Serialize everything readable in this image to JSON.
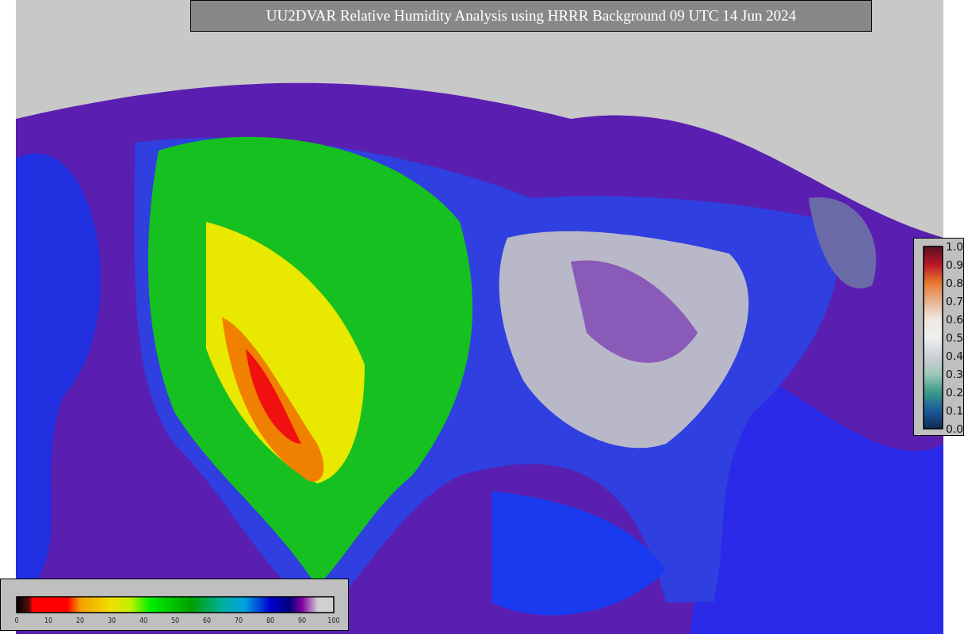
{
  "title": "UU2DVAR Relative Humidity Analysis using HRRR Background 09 UTC 14 Jun 2024",
  "humidity_colorbar": {
    "ticks": [
      "0",
      "10",
      "20",
      "30",
      "40",
      "50",
      "60",
      "70",
      "80",
      "90",
      "100"
    ]
  },
  "ratio_colorbar": {
    "ticks": [
      "1.0",
      "0.9",
      "0.8",
      "0.7",
      "0.6",
      "0.5",
      "0.4",
      "0.3",
      "0.2",
      "0.1",
      "0.0"
    ]
  }
}
